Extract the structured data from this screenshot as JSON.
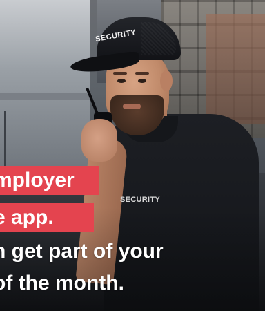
{
  "hero": {
    "cap_text": "SECURITY",
    "shirt_text": "SECURITY"
  },
  "banner": {
    "line1": "mployer",
    "line2": "e app.",
    "headline_line1": "n get part of your",
    "headline_line2": "of the month."
  },
  "colors": {
    "accent": "#e4444f",
    "text": "#ffffff"
  }
}
